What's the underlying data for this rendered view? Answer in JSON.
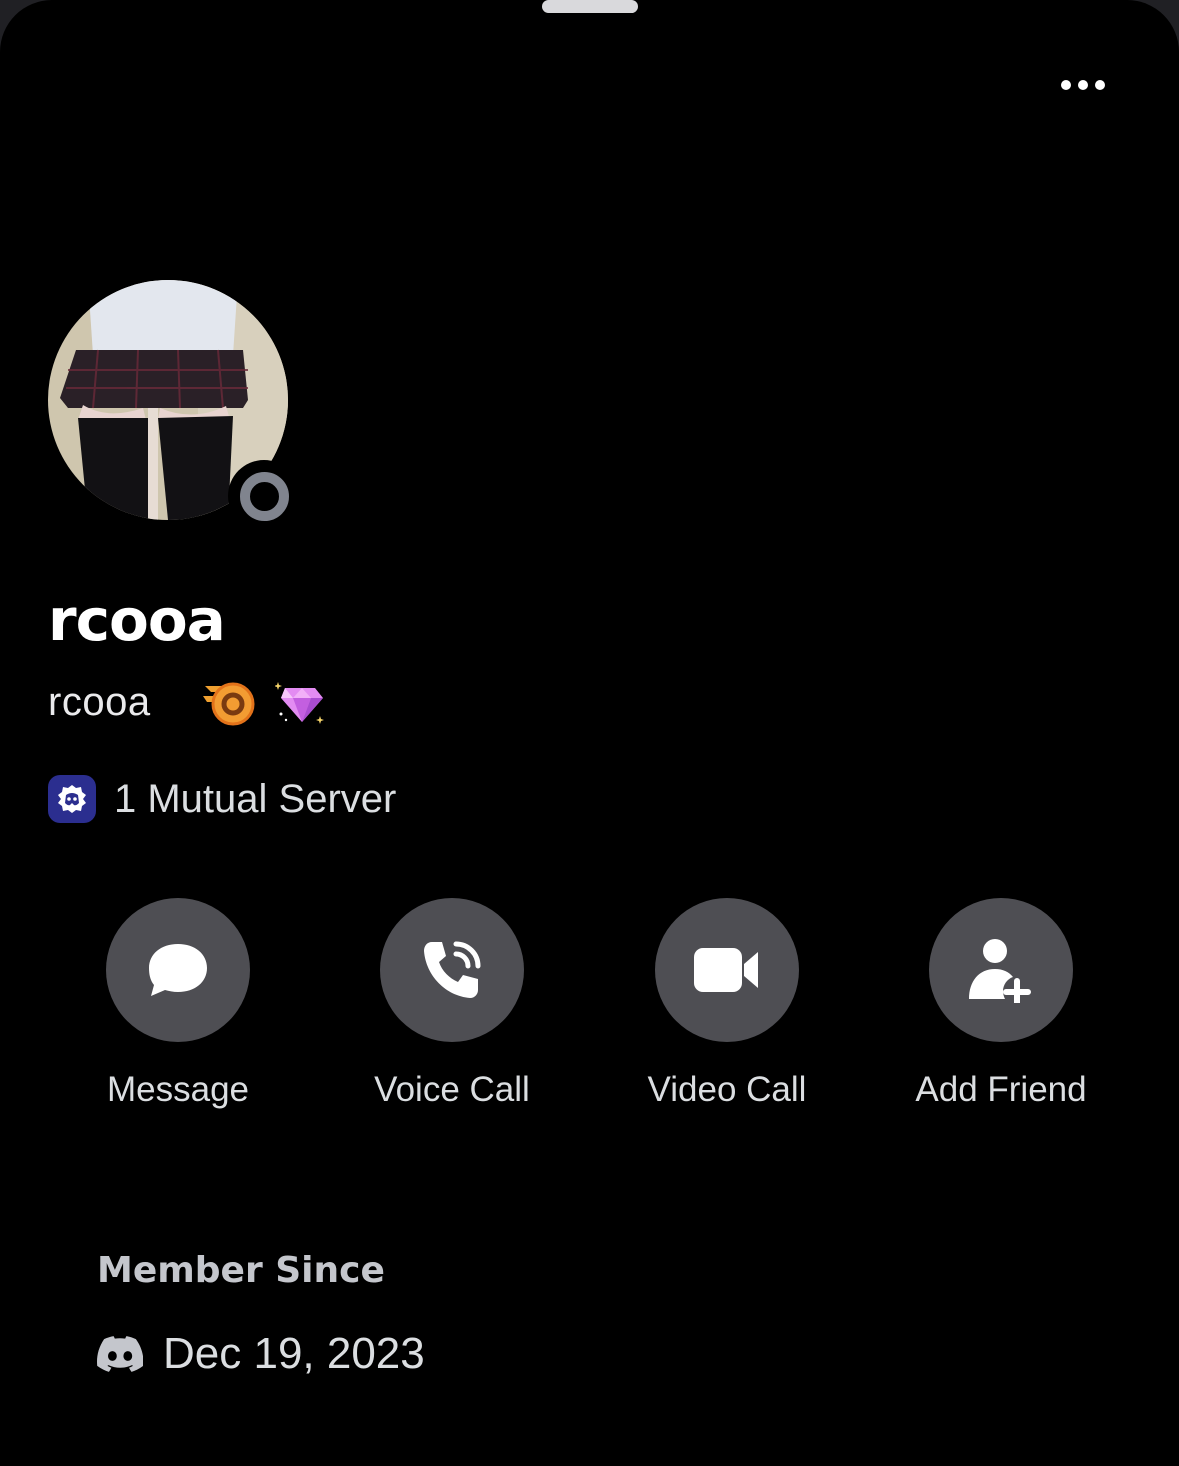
{
  "profile": {
    "display_name": "rcooa",
    "username": "rcooa",
    "status": "offline",
    "status_color": "#80848e",
    "badges": [
      "nitro-boost-badge",
      "gem-badge"
    ]
  },
  "header": {
    "more_icon": "more-horizontal-icon"
  },
  "mutual": {
    "label": "1 Mutual Server",
    "icon": "server-icon"
  },
  "actions": [
    {
      "label": "Message",
      "icon": "chat-bubble-icon"
    },
    {
      "label": "Voice Call",
      "icon": "phone-icon"
    },
    {
      "label": "Video Call",
      "icon": "video-camera-icon"
    },
    {
      "label": "Add Friend",
      "icon": "add-friend-icon"
    }
  ],
  "member_since": {
    "title": "Member Since",
    "date": "Dec 19, 2023",
    "icon": "discord-logo-icon"
  },
  "colors": {
    "background": "#000000",
    "action_button": "#4e4e53",
    "server_icon": "#2b2e8f"
  }
}
